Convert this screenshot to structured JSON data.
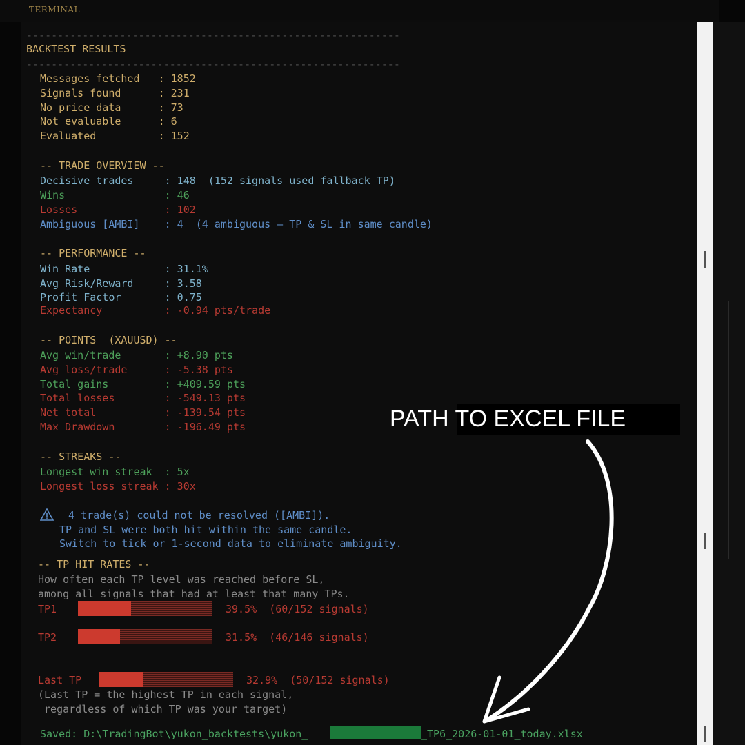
{
  "window": {
    "tab_label": "TERMINAL"
  },
  "header": {
    "rule": "------------------------------------------------------------",
    "title": "BACKTEST RESULTS"
  },
  "summary": [
    "Messages fetched   : 1852",
    "Signals found      : 231",
    "No price data      : 73",
    "Not evaluable      : 6",
    "Evaluated          : 152"
  ],
  "trade_overview": {
    "heading": "-- TRADE OVERVIEW --",
    "decisive": "Decisive trades     : 148  (152 signals used fallback TP)",
    "wins": "Wins                : 46",
    "losses": "Losses              : 102",
    "ambiguous": "Ambiguous [AMBI]    : 4  (4 ambiguous — TP & SL in same candle)"
  },
  "performance": {
    "heading": "-- PERFORMANCE --",
    "win_rate": "Win Rate            : 31.1%",
    "avg_rr": "Avg Risk/Reward     : 3.58",
    "profit_factor": "Profit Factor       : 0.75",
    "expectancy": "Expectancy          : -0.94 pts/trade"
  },
  "points": {
    "heading": "-- POINTS  (XAUUSD) --",
    "avg_win": "Avg win/trade       : +8.90 pts",
    "avg_loss": "Avg loss/trade      : -5.38 pts",
    "total_gains": "Total gains         : +409.59 pts",
    "total_losses": "Total losses        : -549.13 pts",
    "net_total": "Net total           : -139.54 pts",
    "max_drawdown": "Max Drawdown        : -196.49 pts"
  },
  "streaks": {
    "heading": "-- STREAKS --",
    "win": "Longest win streak  : 5x",
    "loss": "Longest loss streak : 30x"
  },
  "warning": {
    "icon": "warning-triangle-icon",
    "line1": "4 trade(s) could not be resolved ([AMBI]).",
    "line2": "TP and SL were both hit within the same candle.",
    "line3": "Switch to tick or 1-second data to eliminate ambiguity."
  },
  "tp_hit_rates": {
    "heading": "-- TP HIT RATES --",
    "desc1": "How often each TP level was reached before SL,",
    "desc2": "among all signals that had at least that many TPs.",
    "rows": [
      {
        "label": "TP1",
        "percent": 39.5,
        "text": "39.5%  (60/152 signals)"
      },
      {
        "label": "TP2",
        "percent": 31.5,
        "text": "31.5%  (46/146 signals)"
      }
    ],
    "last": {
      "label": "Last TP",
      "percent": 32.9,
      "text": "32.9%  (50/152 signals)"
    },
    "note1": "(Last TP = the highest TP in each signal,",
    "note2": " regardless of which TP was your target)"
  },
  "saved": {
    "prefix": "Saved: D:\\TradingBot\\yukon_backtests\\yukon_",
    "suffix": "_TP6_2026-01-01_today.xlsx"
  },
  "annotation": {
    "text": "PATH TO EXCEL FILE"
  },
  "colors": {
    "bar_fill": "#cc3a2e",
    "heading": "#cfae6b",
    "win": "#4da05a",
    "loss": "#b73a32"
  }
}
